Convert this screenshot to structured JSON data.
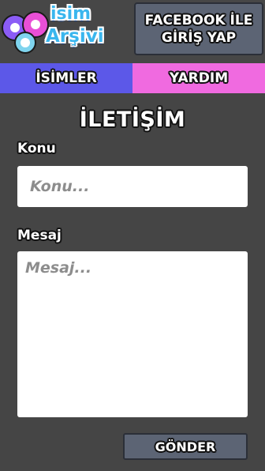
{
  "header": {
    "logo_line1": "isim",
    "logo_line2": "Arşivi",
    "facebook_button_label": "FACEBOOK İLE GİRİŞ YAP"
  },
  "nav": {
    "tabs": [
      {
        "label": "İSİMLER",
        "color": "#5c58e8"
      },
      {
        "label": "YARDIM",
        "color": "#f06ae0"
      }
    ]
  },
  "page": {
    "title": "İLETİŞİM"
  },
  "form": {
    "subject_label": "Konu",
    "subject_placeholder": "Konu...",
    "subject_value": "",
    "message_label": "Mesaj",
    "message_placeholder": "Mesaj...",
    "message_value": "",
    "send_label": "GÖNDER"
  },
  "colors": {
    "background": "#454545",
    "button": "#5c6474",
    "logo_blue": "#3ab6ee"
  }
}
